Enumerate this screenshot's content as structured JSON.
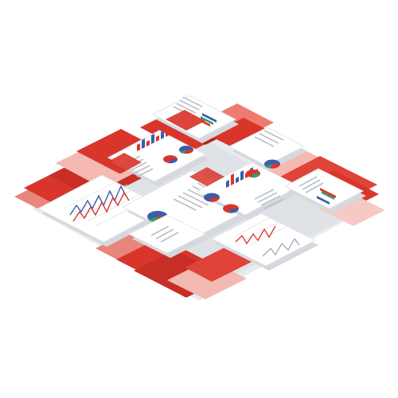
{
  "illustration": {
    "kind": "isometric collage of report documents with charts",
    "text_visible": false
  },
  "colors": {
    "background": "#ffffff",
    "accent_red": "#d9352b",
    "dark_red": "#b6261f",
    "light_red": "#ef7a70",
    "pale_red": "#f6c9c5",
    "paper": "#ffffff",
    "paper_edge": "#e3e6ea",
    "shadow_gray": "#d5d9de",
    "line_gray": "#9aa3ad",
    "chart_blue": "#3b5ea8",
    "chart_red": "#d9352b",
    "chart_green": "#2e9e6e"
  },
  "icons": [
    "pie-chart-icon",
    "bar-chart-icon",
    "line-chart-icon",
    "text-lines-icon"
  ]
}
